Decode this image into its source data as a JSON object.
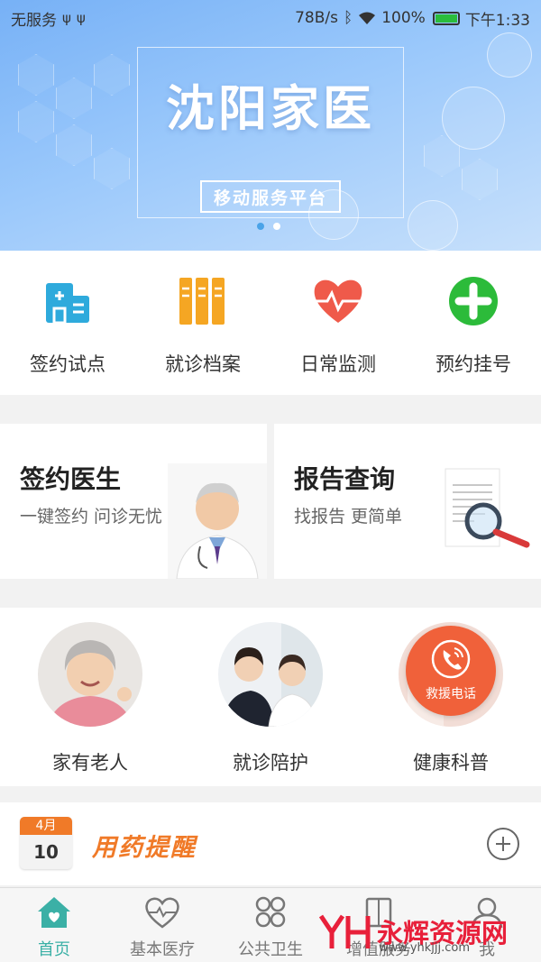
{
  "status_bar": {
    "carrier": "无服务",
    "speed": "78B/s",
    "battery": "100%",
    "time": "下午1:33"
  },
  "banner": {
    "title": "沈阳家医",
    "subtitle": "移动服务平台",
    "pages": 2,
    "active_page": 1
  },
  "quick_actions": [
    {
      "label": "签约试点",
      "icon": "hospital-icon",
      "color": "#2eaadc"
    },
    {
      "label": "就诊档案",
      "icon": "books-icon",
      "color": "#f5a623"
    },
    {
      "label": "日常监测",
      "icon": "heart-pulse-icon",
      "color": "#ef5a4a"
    },
    {
      "label": "预约挂号",
      "icon": "plus-cross-icon",
      "color": "#2cbb3a"
    }
  ],
  "features": [
    {
      "title": "签约医生",
      "subtitle": "一键签约 问诊无忧",
      "image": "doctor-image"
    },
    {
      "title": "报告查询",
      "subtitle": "找报告 更简单",
      "image": "report-magnifier-image"
    }
  ],
  "services": [
    {
      "label": "家有老人",
      "image": "elderly-woman-photo"
    },
    {
      "label": "就诊陪护",
      "image": "nurse-consult-photo"
    },
    {
      "label": "健康科普",
      "image": "health-science-photo",
      "overlay_label": "救援电话"
    }
  ],
  "reminder": {
    "month": "4月",
    "day": "10",
    "title": "用药提醒"
  },
  "tabs": [
    {
      "label": "首页",
      "icon": "home-icon",
      "active": true
    },
    {
      "label": "基本医疗",
      "icon": "heart-pulse-outline-icon",
      "active": false
    },
    {
      "label": "公共卫生",
      "icon": "grid-icon",
      "active": false
    },
    {
      "label": "增值服务",
      "icon": "book-icon",
      "active": false
    },
    {
      "label": "我",
      "icon": "user-icon",
      "active": false
    }
  ],
  "watermark": {
    "brand": "永辉资源网",
    "url": "www.yhkjjj.com"
  },
  "colors": {
    "accent_teal": "#3bb0a6",
    "orange": "#f07a28",
    "rescue_red": "#f0613a"
  }
}
